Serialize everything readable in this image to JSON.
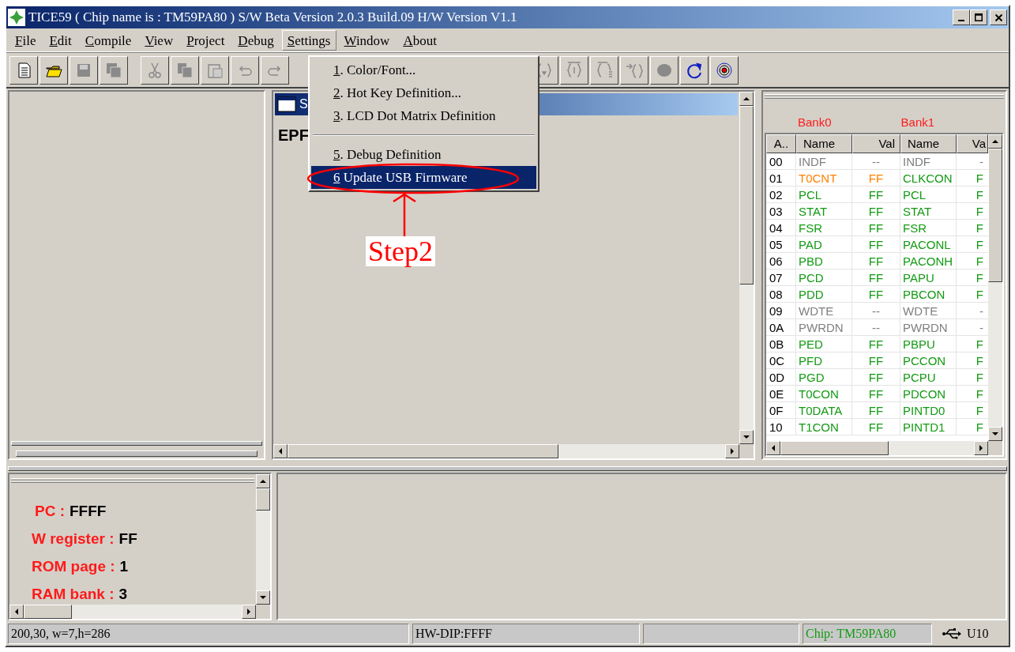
{
  "window": {
    "title": "TICE59 ( Chip name is : TM59PA80 ) S/W Beta Version 2.0.3 Build.09 H/W Version V1.1"
  },
  "menu_bar": [
    {
      "key": "F",
      "text": "ile",
      "selected": false
    },
    {
      "key": "E",
      "text": "dit",
      "selected": false
    },
    {
      "key": "C",
      "text": "ompile",
      "selected": false
    },
    {
      "key": "V",
      "text": "iew",
      "selected": false
    },
    {
      "key": "P",
      "text": "roject",
      "selected": false
    },
    {
      "key": "D",
      "text": "ebug",
      "selected": false
    },
    {
      "key": "S",
      "text": "ettings",
      "selected": true
    },
    {
      "key": "W",
      "text": "indow",
      "selected": false
    },
    {
      "key": "A",
      "text": "bout",
      "selected": false
    }
  ],
  "settings_menu": [
    {
      "kind": "item",
      "key": "1",
      "text": ". Color/Font...",
      "selected": false
    },
    {
      "kind": "item",
      "key": "2",
      "text": ". Hot Key Definition...",
      "selected": false
    },
    {
      "kind": "item",
      "key": "3",
      "text": ". LCD Dot Matrix Definition",
      "selected": false
    },
    {
      "kind": "separator"
    },
    {
      "kind": "item",
      "key": "5",
      "text": ". Debug Definition",
      "selected": false
    },
    {
      "kind": "item",
      "key": "6",
      "text": " Update USB Firmware",
      "selected": true
    }
  ],
  "editor_window": {
    "title": "S",
    "content": "EPF"
  },
  "register_panel": {
    "banks": [
      "Bank0",
      "Bank1"
    ],
    "columns": [
      "A..",
      "Name",
      "Val",
      "Name",
      "Va"
    ],
    "rows": [
      {
        "address": "00",
        "bank0": {
          "name": "INDF",
          "value": "--",
          "color": "#808080"
        },
        "bank1": {
          "name": "INDF",
          "value": "-",
          "color": "#808080"
        }
      },
      {
        "address": "01",
        "bank0": {
          "name": "T0CNT",
          "value": "FF",
          "color": "#ff8000"
        },
        "bank1": {
          "name": "CLKCON",
          "value": "F",
          "color": "#139a13"
        }
      },
      {
        "address": "02",
        "bank0": {
          "name": "PCL",
          "value": "FF",
          "color": "#139a13"
        },
        "bank1": {
          "name": "PCL",
          "value": "F",
          "color": "#139a13"
        }
      },
      {
        "address": "03",
        "bank0": {
          "name": "STAT",
          "value": "FF",
          "color": "#139a13"
        },
        "bank1": {
          "name": "STAT",
          "value": "F",
          "color": "#139a13"
        }
      },
      {
        "address": "04",
        "bank0": {
          "name": "FSR",
          "value": "FF",
          "color": "#139a13"
        },
        "bank1": {
          "name": "FSR",
          "value": "F",
          "color": "#139a13"
        }
      },
      {
        "address": "05",
        "bank0": {
          "name": "PAD",
          "value": "FF",
          "color": "#139a13"
        },
        "bank1": {
          "name": "PACONL",
          "value": "F",
          "color": "#139a13"
        }
      },
      {
        "address": "06",
        "bank0": {
          "name": "PBD",
          "value": "FF",
          "color": "#139a13"
        },
        "bank1": {
          "name": "PACONH",
          "value": "F",
          "color": "#139a13"
        }
      },
      {
        "address": "07",
        "bank0": {
          "name": "PCD",
          "value": "FF",
          "color": "#139a13"
        },
        "bank1": {
          "name": "PAPU",
          "value": "F",
          "color": "#139a13"
        }
      },
      {
        "address": "08",
        "bank0": {
          "name": "PDD",
          "value": "FF",
          "color": "#139a13"
        },
        "bank1": {
          "name": "PBCON",
          "value": "F",
          "color": "#139a13"
        }
      },
      {
        "address": "09",
        "bank0": {
          "name": "WDTE",
          "value": "--",
          "color": "#808080"
        },
        "bank1": {
          "name": "WDTE",
          "value": "-",
          "color": "#808080"
        }
      },
      {
        "address": "0A",
        "bank0": {
          "name": "PWRDN",
          "value": "--",
          "color": "#808080"
        },
        "bank1": {
          "name": "PWRDN",
          "value": "-",
          "color": "#808080"
        }
      },
      {
        "address": "0B",
        "bank0": {
          "name": "PED",
          "value": "FF",
          "color": "#139a13"
        },
        "bank1": {
          "name": "PBPU",
          "value": "F",
          "color": "#139a13"
        }
      },
      {
        "address": "0C",
        "bank0": {
          "name": "PFD",
          "value": "FF",
          "color": "#139a13"
        },
        "bank1": {
          "name": "PCCON",
          "value": "F",
          "color": "#139a13"
        }
      },
      {
        "address": "0D",
        "bank0": {
          "name": "PGD",
          "value": "FF",
          "color": "#139a13"
        },
        "bank1": {
          "name": "PCPU",
          "value": "F",
          "color": "#139a13"
        }
      },
      {
        "address": "0E",
        "bank0": {
          "name": "T0CON",
          "value": "FF",
          "color": "#139a13"
        },
        "bank1": {
          "name": "PDCON",
          "value": "F",
          "color": "#139a13"
        }
      },
      {
        "address": "0F",
        "bank0": {
          "name": "T0DATA",
          "value": "FF",
          "color": "#139a13"
        },
        "bank1": {
          "name": "PINTD0",
          "value": "F",
          "color": "#139a13"
        }
      },
      {
        "address": "10",
        "bank0": {
          "name": "T1CON",
          "value": "FF",
          "color": "#139a13"
        },
        "bank1": {
          "name": "PINTD1",
          "value": "F",
          "color": "#139a13"
        }
      }
    ]
  },
  "cpu_status": [
    {
      "label": "PC :",
      "value": "FFFF"
    },
    {
      "label": "W register :",
      "value": "FF"
    },
    {
      "label": "ROM page :",
      "value": "1"
    },
    {
      "label": "RAM bank :",
      "value": "3"
    }
  ],
  "status_bar": {
    "position": "200,30, w=7,h=286",
    "dip": "HW-DIP:FFFF",
    "chip": "Chip: TM59PA80",
    "port": "U10"
  },
  "annotation": {
    "label": "Step2"
  }
}
